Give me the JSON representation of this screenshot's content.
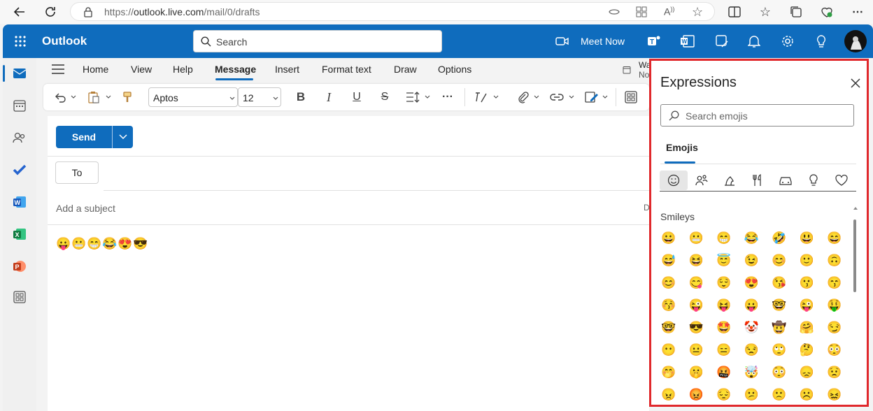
{
  "browser": {
    "url_prefix": "https://",
    "url_host": "outlook.live.com",
    "url_path": "/mail/0/drafts"
  },
  "header": {
    "app_name": "Outlook",
    "search_placeholder": "Search",
    "meet_now_label": "Meet Now",
    "accent_color": "#0f6cbd"
  },
  "ribbon": {
    "tabs": [
      "Home",
      "View",
      "Help",
      "Message",
      "Insert",
      "Format text",
      "Draw",
      "Options"
    ],
    "active_tab": "Message",
    "font_name": "Aptos",
    "font_size": "12",
    "overflow_text_1": "Wa",
    "overflow_text_2": "No"
  },
  "compose": {
    "send_label": "Send",
    "to_label": "To",
    "subject_placeholder": "Add a subject",
    "draft_indicator": "D",
    "body_emojis": [
      "😛",
      "😬",
      "😁",
      "😂",
      "😍",
      "😎"
    ]
  },
  "expressions": {
    "title": "Expressions",
    "search_placeholder": "Search emojis",
    "tab_label": "Emojis",
    "categories": [
      "smiley-icon",
      "people-icon",
      "animal-icon",
      "food-icon",
      "car-icon",
      "lightbulb-icon",
      "heart-icon"
    ],
    "section_label": "Smileys",
    "border_color": "#e0282c",
    "grid": [
      "😀",
      "😬",
      "😁",
      "😂",
      "🤣",
      "😃",
      "😄",
      "😅",
      "😆",
      "😇",
      "😉",
      "😊",
      "🙂",
      "🙃",
      "😊",
      "😋",
      "😌",
      "😍",
      "😘",
      "😗",
      "😙",
      "😚",
      "😜",
      "😝",
      "😛",
      "🤓",
      "😜",
      "🤑",
      "🤓",
      "😎",
      "🤩",
      "🤡",
      "🤠",
      "🤗",
      "😏",
      "😶",
      "😐",
      "😑",
      "😒",
      "🙄",
      "🤔",
      "😳",
      "🤭",
      "🤫",
      "🤬",
      "🤯",
      "😳",
      "😞",
      "😟",
      "😠",
      "😡",
      "😔",
      "😕",
      "🙁",
      "☹️",
      "😖"
    ]
  }
}
